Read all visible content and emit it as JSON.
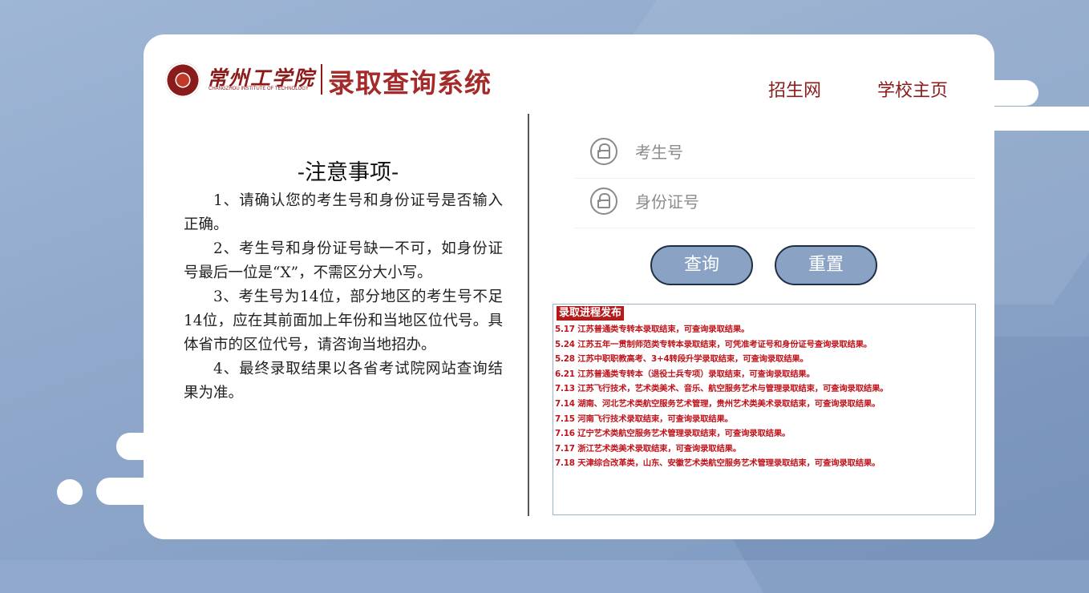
{
  "header": {
    "school_name": "常州工学院",
    "school_name_en": "CHANGZHOU INSTITUTE OF TECHNOLOGY",
    "system_title": "录取查询系统",
    "nav": [
      {
        "label": "招生网"
      },
      {
        "label": "学校主页"
      }
    ]
  },
  "notice": {
    "title": "-注意事项-",
    "items": [
      "1、请确认您的考生号和身份证号是否输入正确。",
      "2、考生号和身份证号缺一不可，如身份证号最后一位是“X”，不需区分大小写。",
      "3、考生号为14位，部分地区的考生号不足14位，应在其前面加上年份和当地区位代号。具体省市的区位代号，请咨询当地招办。",
      "4、最终录取结果以各省考试院网站查询结果为准。"
    ]
  },
  "form": {
    "candidate_placeholder": "考生号",
    "id_placeholder": "身份证号",
    "query_label": "查询",
    "reset_label": "重置"
  },
  "news": {
    "title": "录取进程发布",
    "items": [
      "5.17 江苏普通类专转本录取结束，可查询录取结果。",
      "5.24 江苏五年一贯制师范类专转本录取结束，可凭准考证号和身份证号查询录取结果。",
      "5.28 江苏中职职教高考、3+4转段升学录取结束，可查询录取结果。",
      "6.21 江苏普通类专转本（退役士兵专项）录取结束，可查询录取结果。",
      "7.13 江苏飞行技术，艺术类美术、音乐、航空服务艺术与管理录取结束，可查询录取结果。",
      "7.14 湖南、河北艺术类航空服务艺术管理，贵州艺术类美术录取结束，可查询录取结果。",
      "7.15 河南飞行技术录取结束，可查询录取结果。",
      "7.16 辽宁艺术类航空服务艺术管理录取结束，可查询录取结果。",
      "7.17 浙江艺术类美术录取结束，可查询录取结果。",
      "7.18 天津综合改革类，山东、安徽艺术类航空服务艺术管理录取结束，可查询录取结果。"
    ]
  },
  "colors": {
    "brand_red": "#8b1a1a",
    "news_red": "#c0141c",
    "button_blue": "#8aa2c4",
    "background_blue": "#8fa8cb"
  }
}
